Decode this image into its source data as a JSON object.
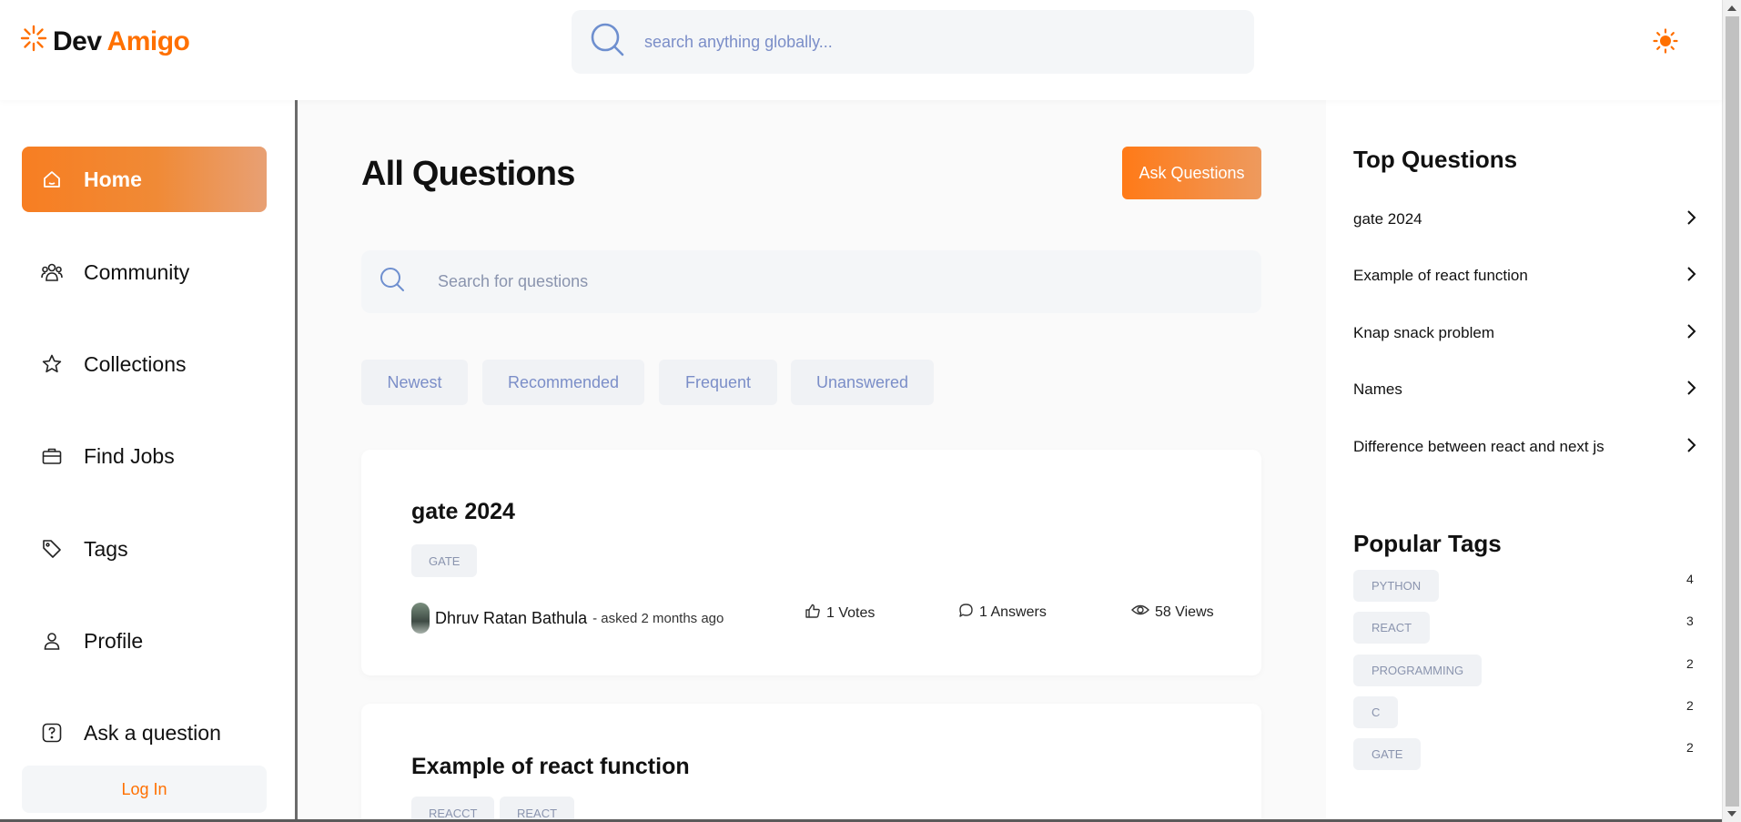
{
  "app": {
    "logo_part1": "Dev",
    "logo_part2": "Amigo",
    "brand_color": "#ff7000"
  },
  "header": {
    "search_placeholder": "search anything globally...",
    "theme_icon": "sun-icon"
  },
  "sidebar": {
    "items": [
      {
        "label": "Home",
        "icon": "home-icon",
        "active": true
      },
      {
        "label": "Community",
        "icon": "users-icon",
        "active": false
      },
      {
        "label": "Collections",
        "icon": "star-icon",
        "active": false
      },
      {
        "label": "Find Jobs",
        "icon": "briefcase-icon",
        "active": false
      },
      {
        "label": "Tags",
        "icon": "tag-icon",
        "active": false
      },
      {
        "label": "Profile",
        "icon": "user-icon",
        "active": false
      },
      {
        "label": "Ask a question",
        "icon": "question-icon",
        "active": false
      }
    ],
    "login_label": "Log In"
  },
  "main": {
    "title": "All Questions",
    "ask_button": "Ask Questions",
    "search_placeholder": "Search for questions",
    "filters": [
      "Newest",
      "Recommended",
      "Frequent",
      "Unanswered"
    ],
    "questions": [
      {
        "title": "gate 2024",
        "tags": [
          "GATE"
        ],
        "author": "Dhruv Ratan Bathula",
        "asked": " - asked 2 months ago",
        "votes": "1 Votes",
        "answers": "1 Answers",
        "views": "58 Views"
      },
      {
        "title": "Example of react function",
        "tags": [
          "REACCT",
          "REACT"
        ]
      }
    ]
  },
  "rightbar": {
    "top_questions_heading": "Top Questions",
    "top_questions": [
      "gate 2024",
      "Example of react function",
      "Knap snack problem",
      "Names",
      "Difference between react and next js"
    ],
    "popular_tags_heading": "Popular Tags",
    "popular_tags": [
      {
        "name": "PYTHON",
        "count": "4"
      },
      {
        "name": "REACT",
        "count": "3"
      },
      {
        "name": "PROGRAMMING",
        "count": "2"
      },
      {
        "name": "C",
        "count": "2"
      },
      {
        "name": "GATE",
        "count": "2"
      }
    ]
  }
}
